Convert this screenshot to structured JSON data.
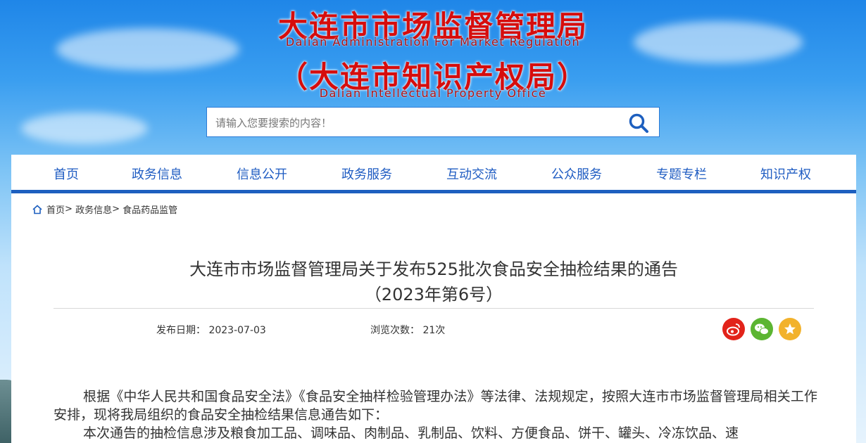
{
  "header": {
    "title_cn": "大连市市场监督管理局",
    "title_en": "Dalian Administration For Market Regulation",
    "subtitle_cn": "（大连市知识产权局）",
    "subtitle_en": "Dalian Intellectual Property Office"
  },
  "search": {
    "placeholder": "请输入您要搜索的内容！"
  },
  "nav": {
    "items": [
      {
        "label": "首页"
      },
      {
        "label": "政务信息"
      },
      {
        "label": "信息公开"
      },
      {
        "label": "政务服务"
      },
      {
        "label": "互动交流"
      },
      {
        "label": "公众服务"
      },
      {
        "label": "专题专栏"
      },
      {
        "label": "知识产权"
      }
    ]
  },
  "breadcrumb": {
    "items": [
      "首页",
      "政务信息",
      "食品药品监管"
    ],
    "separator": ">"
  },
  "article": {
    "title_line1": "大连市市场监督管理局关于发布525批次食品安全抽检结果的通告",
    "title_line2": "（2023年第6号）",
    "date_label": "发布日期：",
    "date_value": "2023-07-03",
    "views_label": "浏览次数：",
    "views_value": "21次",
    "para1": "根据《中华人民共和国食品安全法》《食品安全抽样检验管理办法》等法律、法规规定，按照大连市市场监督管理局相关工作安排，现将我局组织的食品安全抽检结果信息通告如下：",
    "para2": "本次通告的抽检信息涉及粮食加工品、调味品、肉制品、乳制品、饮料、方便食品、饼干、罐头、冷冻饮品、速"
  },
  "share": [
    {
      "icon": "weibo-icon",
      "color": "#e2231a"
    },
    {
      "icon": "wechat-icon",
      "color": "#5cb532"
    },
    {
      "icon": "favorite-icon",
      "color": "#f2b22c"
    }
  ],
  "colors": {
    "nav_text": "#1f5cc2",
    "nav_border": "#1d5fbf",
    "title_red": "#d60d0d"
  }
}
